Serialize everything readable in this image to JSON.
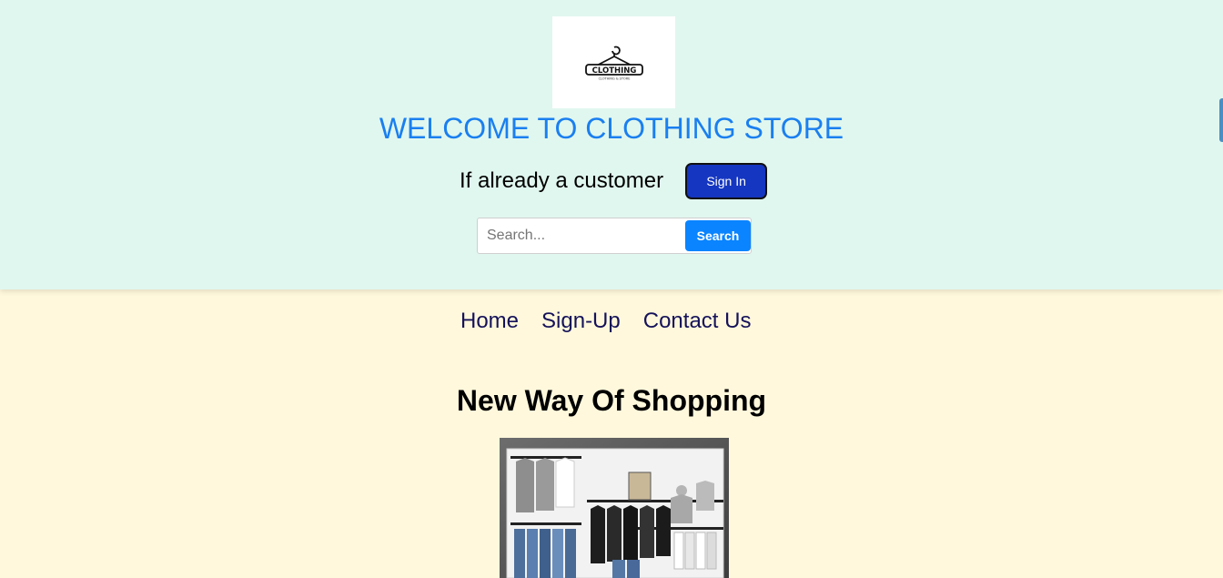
{
  "header": {
    "logo_text": "CLOTHING",
    "logo_tagline": "CLOTHING & STORE",
    "welcome_title": "WELCOME TO CLOTHING STORE",
    "customer_prompt": "If already a customer",
    "signin_label": "Sign In",
    "search": {
      "placeholder": "Search...",
      "button_label": "Search"
    }
  },
  "nav": {
    "items": [
      "Home",
      "Sign-Up",
      "Contact Us"
    ]
  },
  "main": {
    "section_title": "New Way Of Shopping"
  },
  "colors": {
    "header_bg": "#e0f7ef",
    "page_bg": "#fff8dc",
    "title_blue": "#1a7ff0",
    "signin_bg": "#1536c0",
    "search_btn_bg": "#0a84ff",
    "nav_text": "#15125a"
  }
}
